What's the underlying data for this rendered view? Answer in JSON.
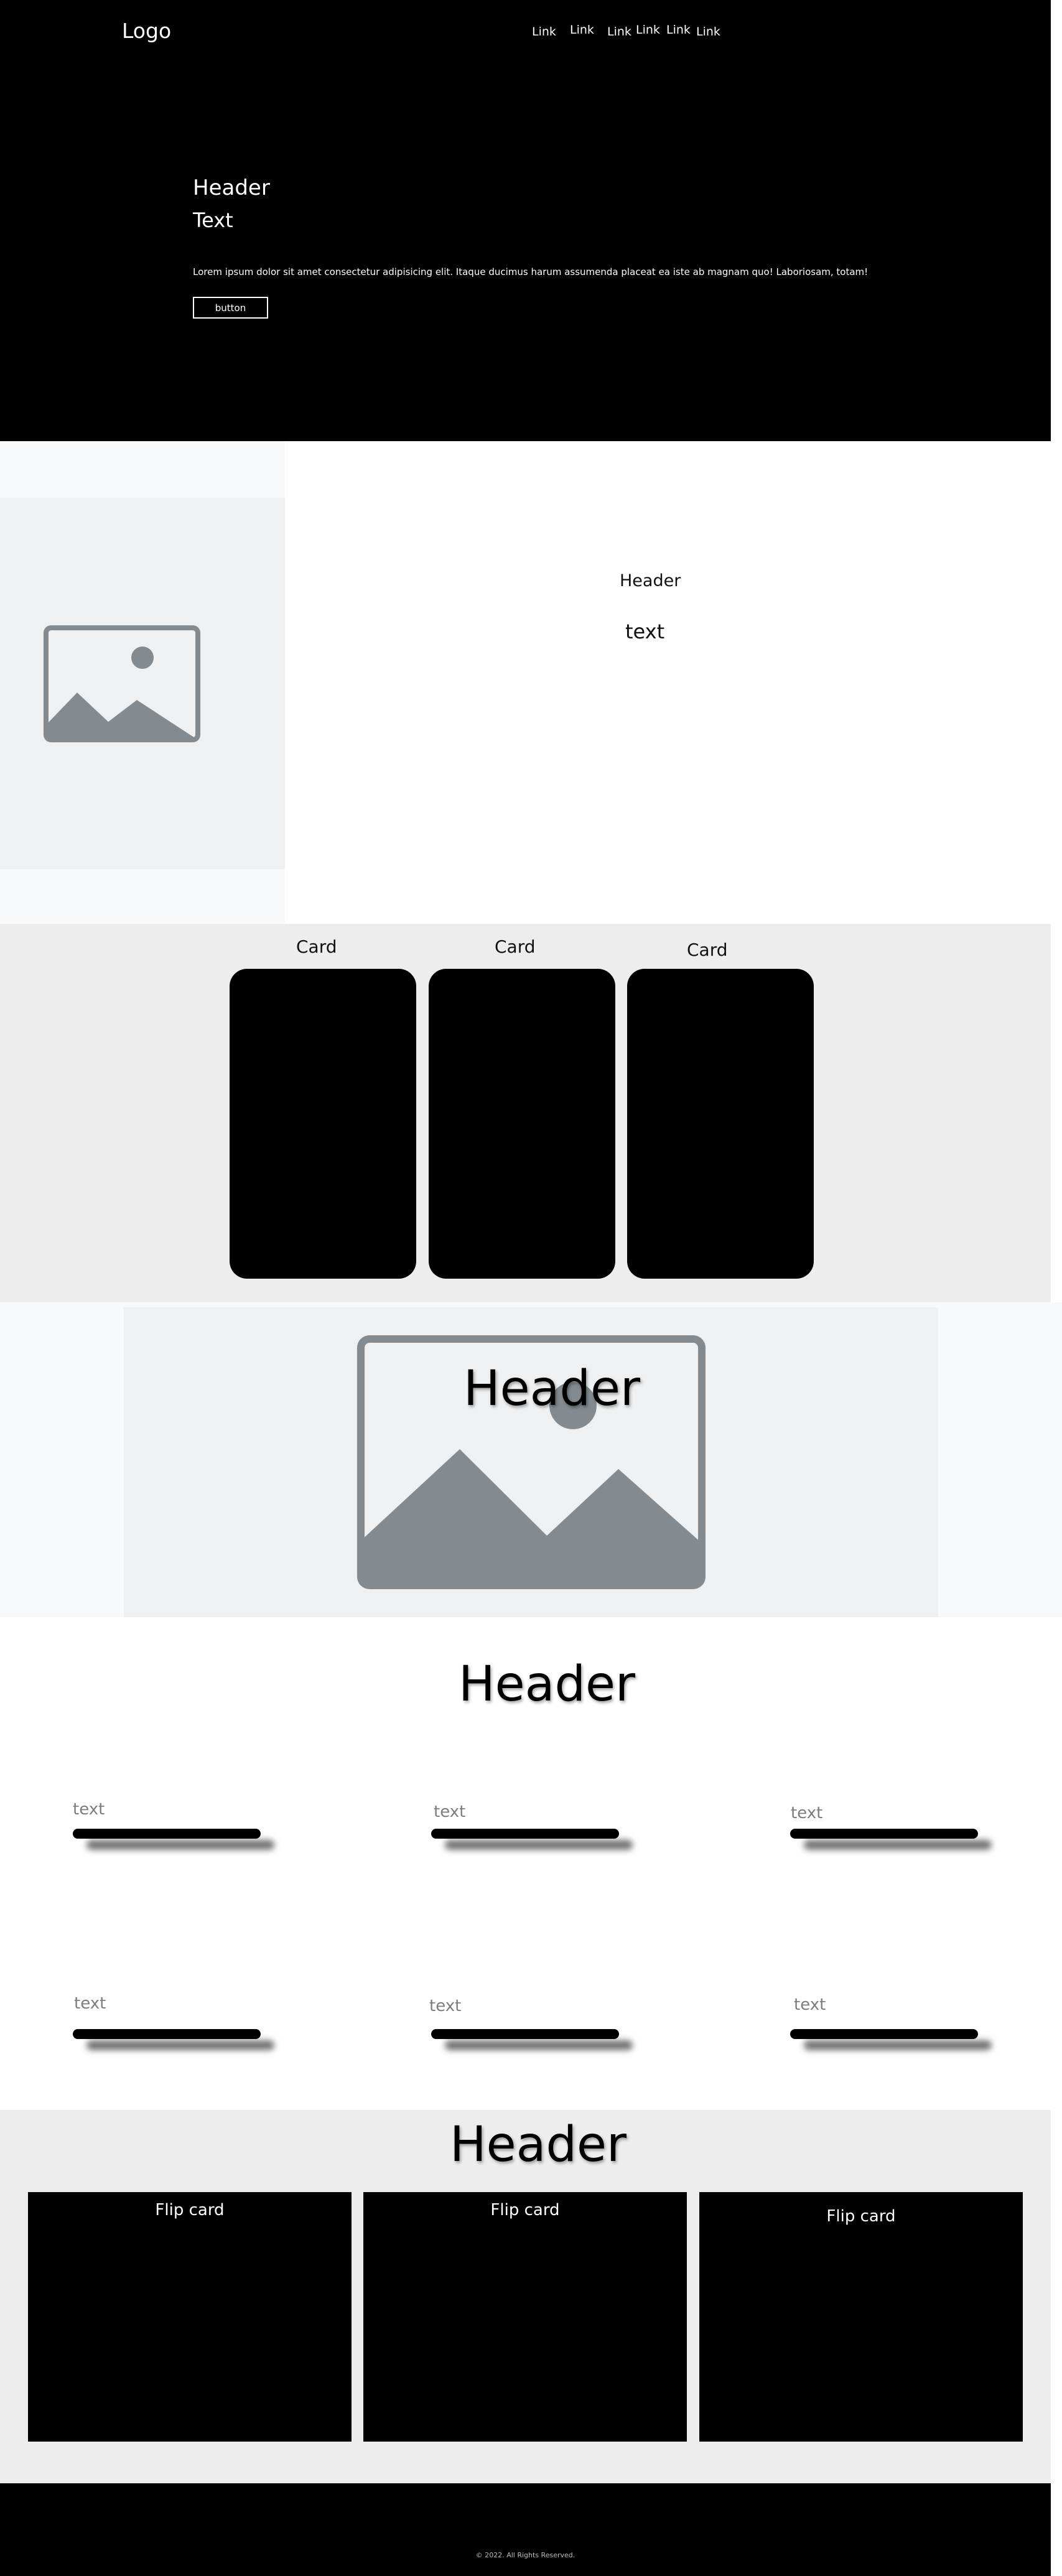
{
  "nav": {
    "logo": "Logo",
    "links": [
      "Link",
      "Link",
      "Link",
      "Link",
      "Link",
      "Link"
    ]
  },
  "hero": {
    "header": "Header",
    "text": "Text",
    "body": "Lorem ipsum dolor sit amet consectetur adipisicing elit. Itaque ducimus harum assumenda placeat ea iste ab magnam quo! Laboriosam, totam!",
    "button_label": "button"
  },
  "about": {
    "header": "Header",
    "text": "text",
    "image_icon": "image-placeholder-icon"
  },
  "cards": {
    "titles": [
      "Card",
      "Card",
      "Card"
    ]
  },
  "banner": {
    "header": "Header",
    "image_icon": "image-placeholder-icon"
  },
  "features": {
    "header": "Header",
    "items": [
      "text",
      "text",
      "text",
      "text",
      "text",
      "text"
    ]
  },
  "flip": {
    "header": "Header",
    "cards": [
      "Flip card",
      "Flip card",
      "Flip card"
    ]
  },
  "footer": {
    "copyright": "© 2022. All Rights Reserved."
  },
  "colors": {
    "dark": "#000000",
    "light_gray": "#ededed",
    "placeholder_bg": "#eef0f2",
    "placeholder_icon": "#838b90"
  }
}
